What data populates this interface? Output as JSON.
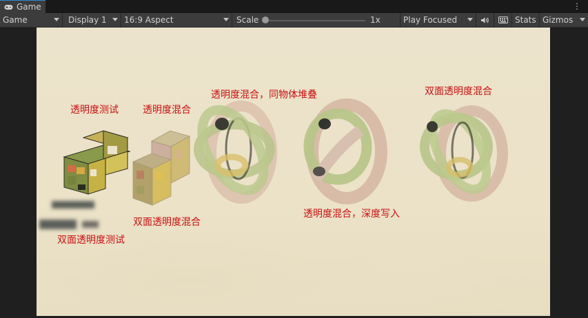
{
  "tab": {
    "label": "Game",
    "icon": "gamepad-icon"
  },
  "toolbar": {
    "view_select": "Game",
    "display_select": "Display 1",
    "aspect_select": "16:9 Aspect",
    "scale_label": "Scale",
    "scale_value": "1x",
    "scale_level": 0,
    "play_mode_select": "Play Focused",
    "stats_label": "Stats",
    "gizmos_label": "Gizmos"
  },
  "scene": {
    "labels": {
      "alpha_test": "透明度测试",
      "alpha_blend": "透明度混合",
      "alpha_blend_stacked": "透明度混合，同物体堆叠",
      "double_sided_blend_top": "双面透明度混合",
      "double_sided_blend": "双面透明度混合",
      "alpha_blend_zwrite": "透明度混合，深度写入",
      "double_sided_test": "双面透明度测试"
    }
  },
  "colors": {
    "label_red": "#c81010",
    "game_bg": "#ece3cc",
    "editor_bg": "#1f1f1f",
    "toolbar": "#3c3c3c",
    "tab_accent": "#2c8bd6"
  }
}
